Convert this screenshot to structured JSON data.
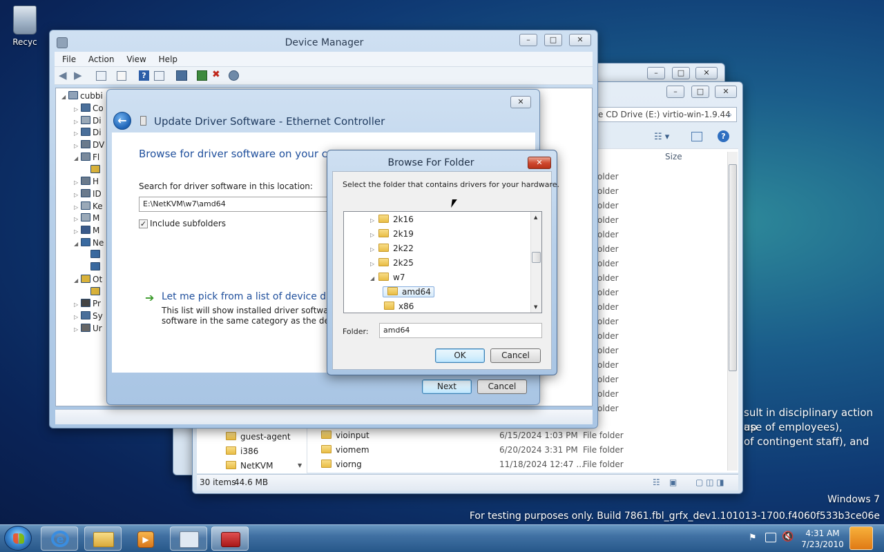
{
  "desktop": {
    "recycle_bin_label": "Recyc",
    "watermark_line1": "Windows 7",
    "watermark_line2": "For testing purposes only. Build 7861.fbl_grfx_dev1.101013-1700.f4060f533b3ce06e",
    "background_text": [
      "sult in disciplinary action up",
      "ase of employees),",
      "of contingent staff), and"
    ]
  },
  "explorer": {
    "address_text": "e CD Drive (E:) virtio-win-1.9.44",
    "column_size": "Size",
    "column_type_partial": "e",
    "type_label": "older",
    "repeated_type_rows": 17,
    "left_folders": [
      "guest-agent",
      "i386",
      "NetKVM"
    ],
    "rows": [
      {
        "name": "vioinput",
        "date": "6/15/2024 1:03 PM",
        "type": "File folder"
      },
      {
        "name": "viomem",
        "date": "6/20/2024 3:31 PM",
        "type": "File folder"
      },
      {
        "name": "viorng",
        "date": "11/18/2024 12:47 ...",
        "type": "File folder"
      }
    ],
    "status_items": "30 items",
    "status_size": "44.6 MB"
  },
  "device_manager": {
    "title": "Device Manager",
    "menu": [
      "File",
      "Action",
      "View",
      "Help"
    ],
    "tree_root": "cubbi",
    "tree_items": [
      "Co",
      "Di",
      "Di",
      "DV",
      "Fl",
      "",
      "H",
      "ID",
      "Ke",
      "M",
      "M",
      "Ne",
      "",
      "",
      "Ot",
      "",
      "Pr",
      "Sy",
      "Ur"
    ]
  },
  "update_driver": {
    "title": "Update Driver Software - Ethernet Controller",
    "heading": "Browse for driver software on your com",
    "search_label": "Search for driver software in this location:",
    "path_value": "E:\\NetKVM\\w7\\amd64",
    "include_subfolders": "Include subfolders",
    "pick_title": "Let me pick from a list of device dr",
    "pick_desc_line1": "This list will show installed driver software co",
    "pick_desc_line2": "software in the same category as the device.",
    "next_label": "Next",
    "cancel_label": "Cancel"
  },
  "browse_folder": {
    "title": "Browse For Folder",
    "instruction": "Select the folder that contains drivers for your hardware.",
    "tree": [
      {
        "label": "2k16",
        "expanded": false,
        "selected": false
      },
      {
        "label": "2k19",
        "expanded": false,
        "selected": false
      },
      {
        "label": "2k22",
        "expanded": false,
        "selected": false
      },
      {
        "label": "2k25",
        "expanded": false,
        "selected": false
      },
      {
        "label": "w7",
        "expanded": true,
        "selected": false
      },
      {
        "label": "amd64",
        "expanded": false,
        "selected": true
      },
      {
        "label": "x86",
        "expanded": false,
        "selected": false
      }
    ],
    "folder_label": "Folder:",
    "folder_value": "amd64",
    "ok_label": "OK",
    "cancel_label": "Cancel"
  },
  "taskbar": {
    "time": "4:31 AM",
    "date": "7/23/2010"
  }
}
